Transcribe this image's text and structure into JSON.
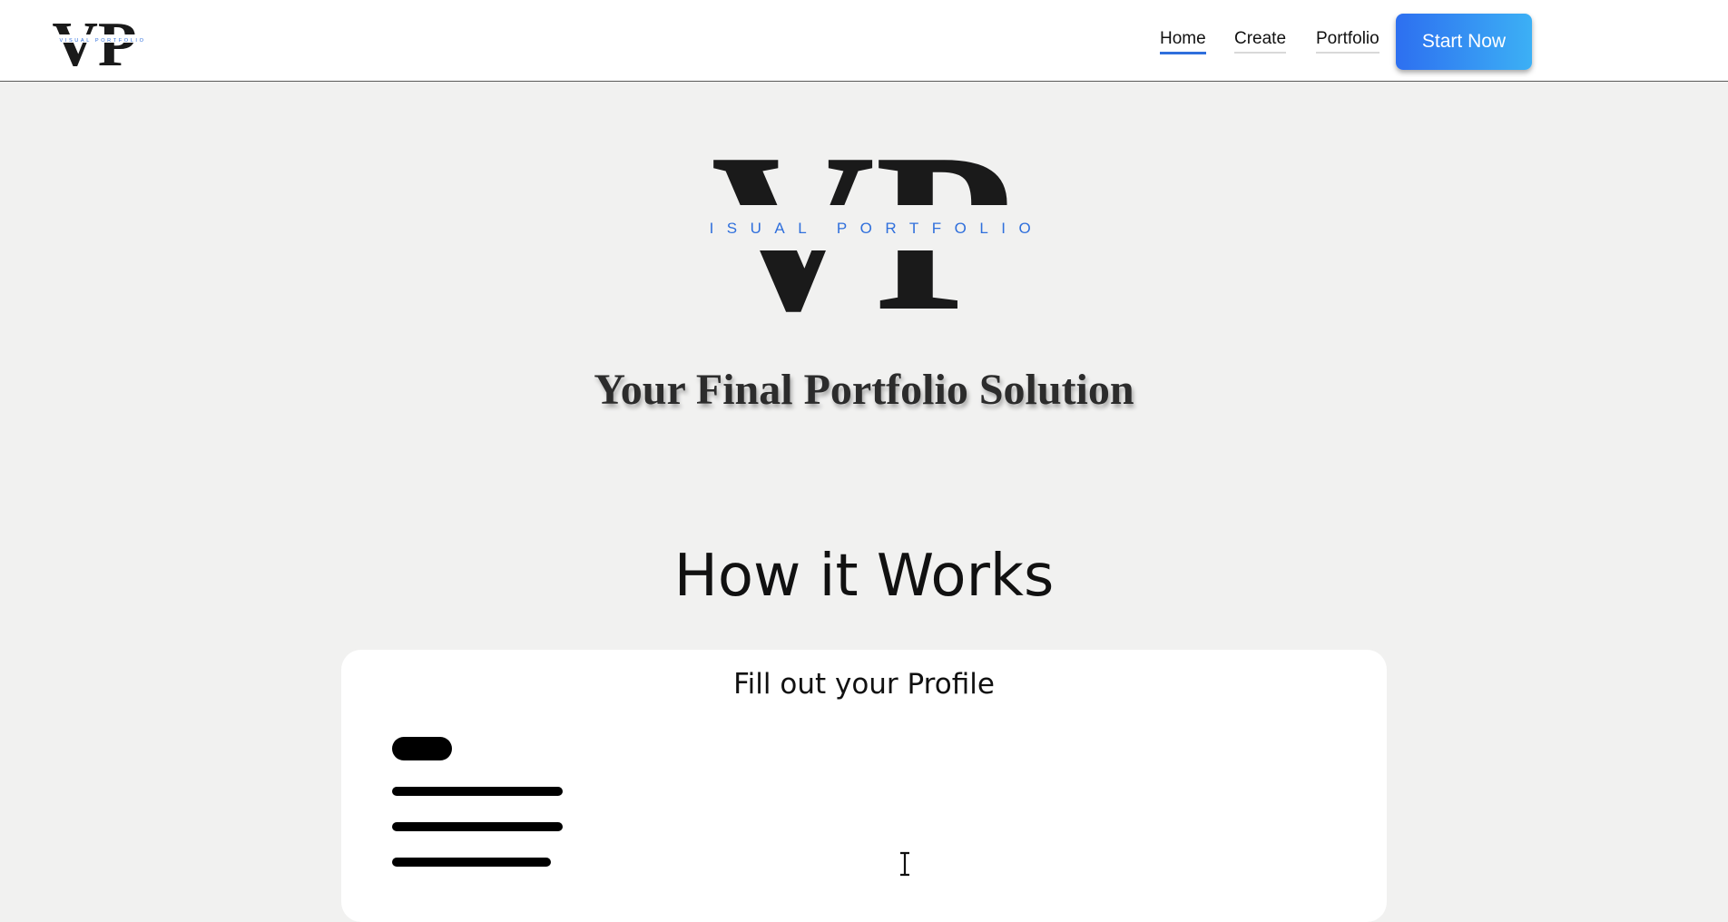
{
  "nav": {
    "logo_letters": "VP",
    "logo_subtitle": "VISUAL PORTFOLIO",
    "links": [
      {
        "label": "Home",
        "active": true
      },
      {
        "label": "Create",
        "active": false
      },
      {
        "label": "Portfolio",
        "active": false
      }
    ],
    "cta_label": "Start Now"
  },
  "hero": {
    "logo_letters": "VP",
    "logo_subtitle": "VISUAL PORTFOLIO",
    "tagline": "Your Final Portfolio Solution"
  },
  "how": {
    "title": "How it Works",
    "card_title": "Fill out your Profile",
    "card_icon": "text-cursor-icon"
  },
  "colors": {
    "accent": "#2f6fdc",
    "cta_gradient_start": "#2d6ff0",
    "cta_gradient_end": "#3cb0f5",
    "background": "#f1f1f0"
  }
}
